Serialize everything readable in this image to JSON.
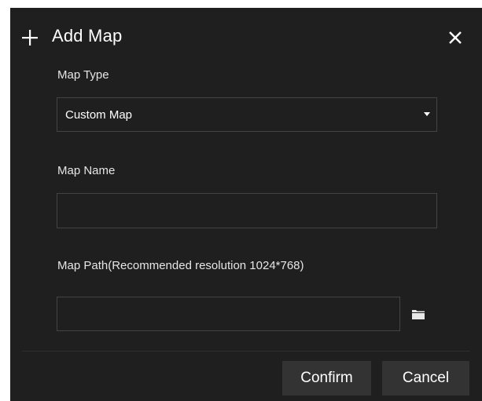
{
  "dialog": {
    "title": "Add Map",
    "map_type": {
      "label": "Map Type",
      "selected_value": "Custom Map"
    },
    "map_name": {
      "label": "Map Name",
      "value": "",
      "placeholder": ""
    },
    "map_path": {
      "label": "Map Path(Recommended resolution 1024*768)",
      "value": "",
      "placeholder": ""
    },
    "buttons": {
      "confirm": "Confirm",
      "cancel": "Cancel"
    }
  },
  "icons": {
    "add": "plus-icon",
    "close": "close-icon",
    "dropdown": "chevron-down-icon",
    "browse": "folder-icon"
  },
  "colors": {
    "dialog_background": "#1f1f1f",
    "border": "#444444",
    "button_background": "#333333",
    "text": "#ffffff"
  }
}
